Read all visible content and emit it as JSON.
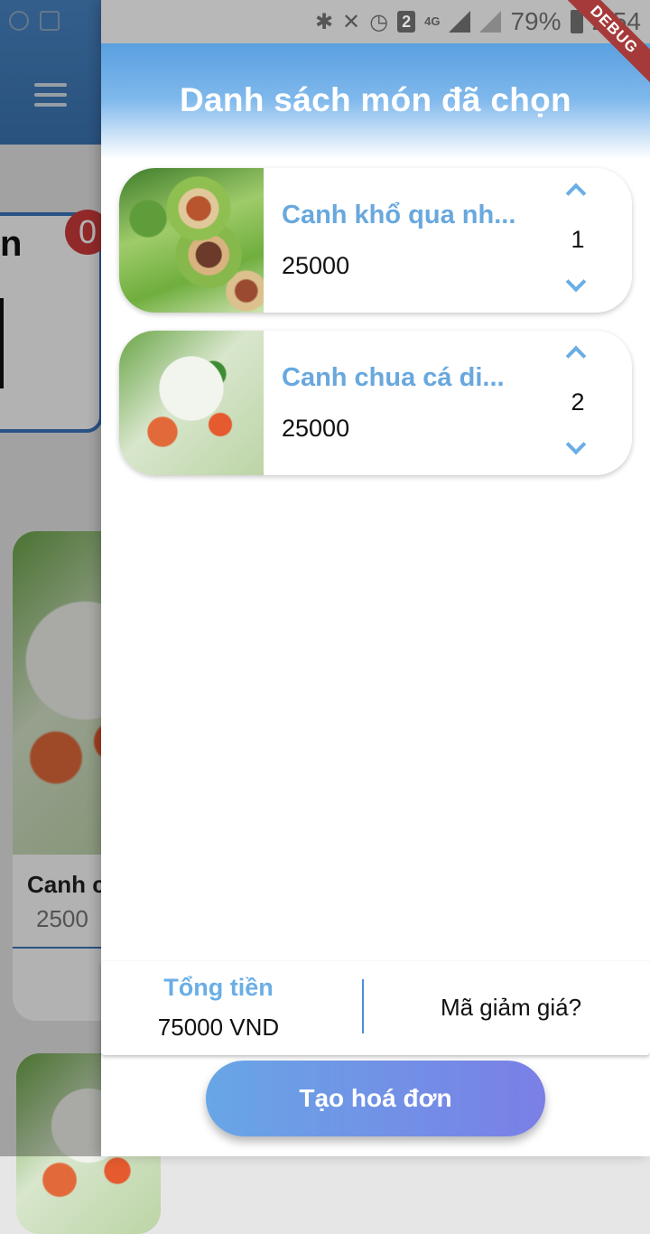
{
  "status_bar": {
    "battery": "79%",
    "time": "2:54",
    "sim_slot": "2",
    "network": "4G",
    "icons": [
      "bluetooth-icon",
      "vibrate-icon",
      "alarm-icon",
      "sim-icon",
      "signal-icon",
      "battery-icon"
    ]
  },
  "debug_label": "DEBUG",
  "background": {
    "cart_title_fragment": "n",
    "cart_badge": "0",
    "food_name": "Canh c",
    "food_price": "2500"
  },
  "drawer": {
    "title": "Danh sách món đã chọn",
    "items": [
      {
        "name": "Canh khổ qua nh...",
        "price": "25000",
        "qty": "1"
      },
      {
        "name": "Canh chua cá di...",
        "price": "25000",
        "qty": "2"
      }
    ],
    "summary": {
      "total_label": "Tổng tiền",
      "total_value": "75000 VND",
      "discount_label": "Mã giảm giá?"
    },
    "create_button": "Tạo hoá đơn"
  },
  "colors": {
    "accent": "#68a8de",
    "appbar": "#4a87c8",
    "button_start": "#68a6e6",
    "button_end": "#7a7fe6",
    "badge": "#d13c3c"
  }
}
